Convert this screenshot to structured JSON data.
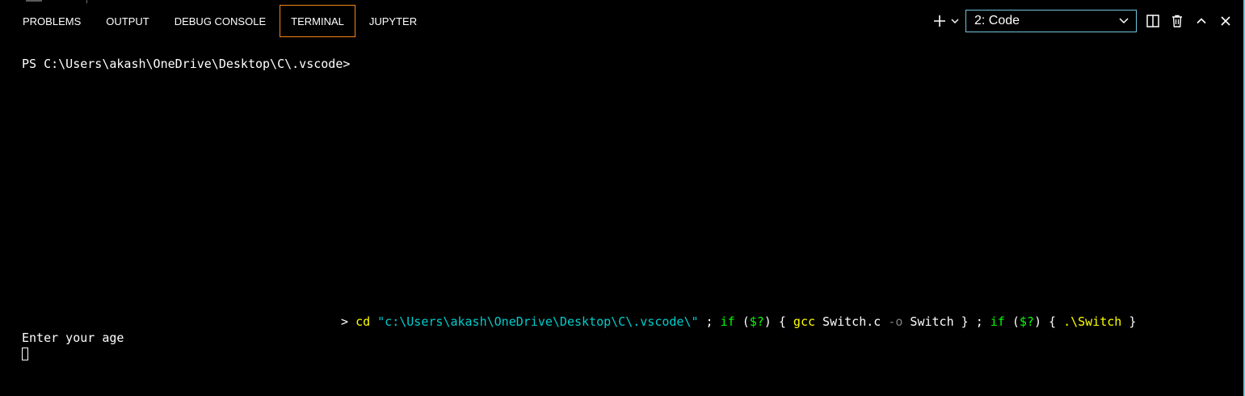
{
  "panel": {
    "tabs": [
      {
        "label": "PROBLEMS"
      },
      {
        "label": "OUTPUT"
      },
      {
        "label": "DEBUG CONSOLE"
      },
      {
        "label": "TERMINAL"
      },
      {
        "label": "JUPYTER"
      }
    ],
    "active_tab": "TERMINAL"
  },
  "actions": {
    "terminal_select_value": "2: Code",
    "icons": [
      "plus-icon",
      "chevron-down-icon",
      "split-icon",
      "trash-icon",
      "chevron-up-icon",
      "close-icon"
    ]
  },
  "terminal": {
    "prompt": "PS C:\\Users\\akash\\OneDrive\\Desktop\\C\\.vscode>",
    "command_tokens": {
      "arrow": "> ",
      "cd": "cd",
      "path": "\"c:\\Users\\akash\\OneDrive\\Desktop\\C\\.vscode\\\"",
      "sep1": " ; ",
      "if1": "if",
      "cond1_open": " (",
      "cond1_var": "$?",
      "cond1_close": ") ",
      "brace1_open": "{ ",
      "gcc": "gcc",
      "src": " Switch.c ",
      "flag": "-o",
      "out": " Switch",
      "brace1_close": " }",
      "sep2": " ; ",
      "if2": "if",
      "cond2_open": " (",
      "cond2_var": "$?",
      "cond2_close": ") ",
      "brace2_open": "{ ",
      "run": ".\\Switch",
      "brace2_close": " }"
    },
    "output": "Enter your age"
  },
  "colors": {
    "background": "#000000",
    "active_tab_border": "#f38518",
    "focus_border": "#6fc3df",
    "command_yellow": "#ffff00",
    "string_cyan": "#00cdcd",
    "keyword_green": "#00ff00",
    "flag_gray": "#808080"
  }
}
